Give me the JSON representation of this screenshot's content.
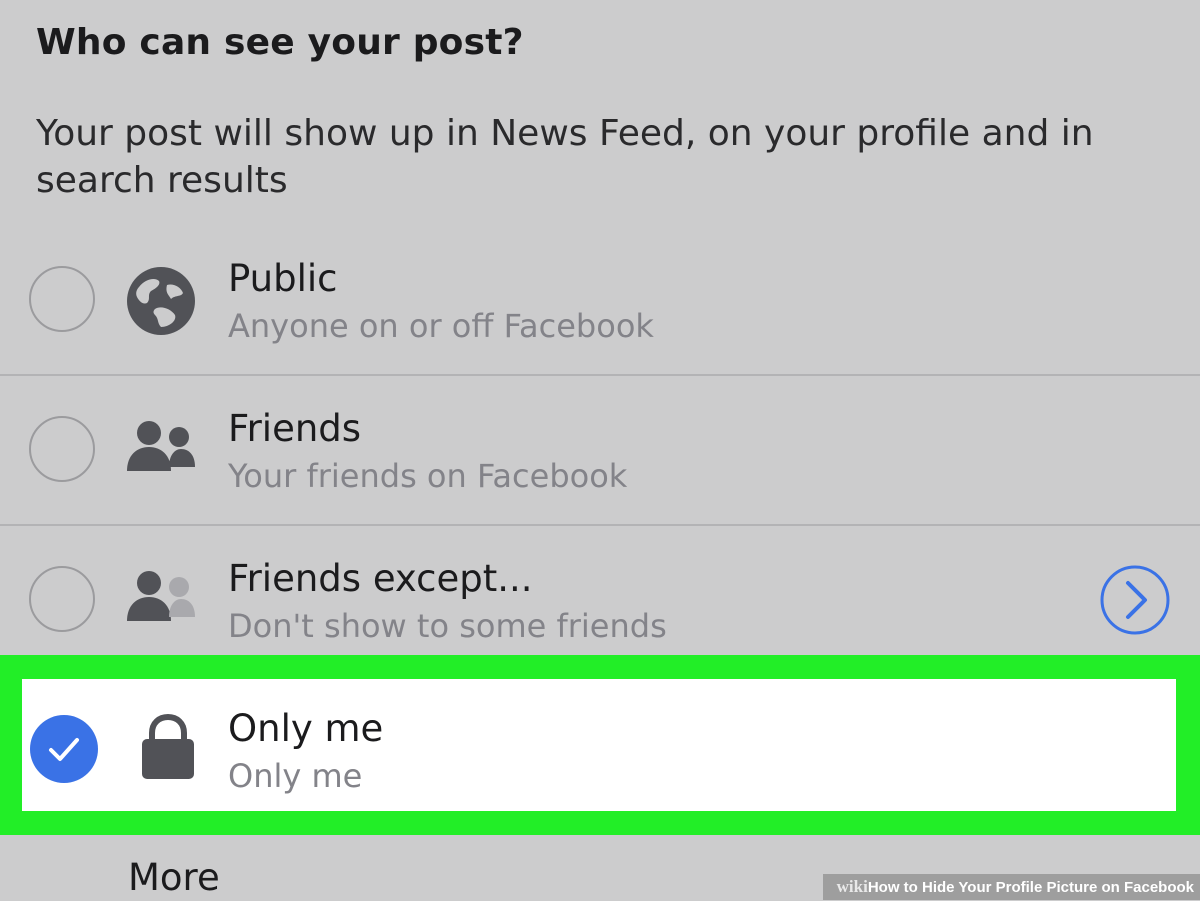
{
  "header": {
    "title": "Who can see your post?",
    "description": "Your post will show up in News Feed, on your profile and in search results"
  },
  "options": [
    {
      "title": "Public",
      "subtitle": "Anyone on or off Facebook",
      "icon": "globe-icon",
      "selected": false
    },
    {
      "title": "Friends",
      "subtitle": "Your friends on Facebook",
      "icon": "friends-icon",
      "selected": false
    },
    {
      "title": "Friends except...",
      "subtitle": "Don't show to some friends",
      "icon": "friends-except-icon",
      "selected": false,
      "has_more_arrow": true
    },
    {
      "title": "Only me",
      "subtitle": "Only me",
      "icon": "lock-icon",
      "selected": true
    }
  ],
  "more": {
    "label": "More"
  },
  "watermark": {
    "brand": "wiki",
    "title": "How to Hide Your Profile Picture on Facebook"
  },
  "colors": {
    "background": "#cccccd",
    "icon": "#515257",
    "accent_blue": "#3a72e6",
    "highlight_green": "#22ee27",
    "subtitle_gray": "#838389"
  }
}
